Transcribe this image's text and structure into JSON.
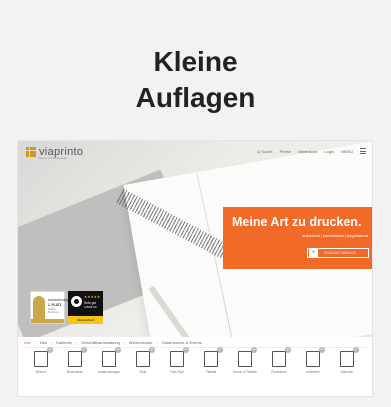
{
  "heading": {
    "line1": "Kleine",
    "line2": "Auflagen"
  },
  "site": {
    "logo_text": "viaprinto",
    "logo_sub": "Meine Art zu drucken",
    "nav": [
      "Q Suche",
      "Preise",
      "Warenkorb",
      "Login",
      "MENU"
    ]
  },
  "banner": {
    "title": "Meine Art zu drucken.",
    "subtitle": "individuell | komfortabel | begeisternd",
    "button_icon": "+",
    "button_label": "PRODUKT WÄHLEN"
  },
  "badges": {
    "quality": {
      "l1": "Auszeichnung",
      "l2": "1. PLATZ",
      "l3": "Online-Druckerei"
    },
    "trusted": {
      "stars": "★★★★★",
      "l1": "Sehr gut",
      "l2": "4.89/5.00",
      "bottom": "Käuferschutz"
    }
  },
  "category_tabs": [
    "Alle",
    "Neu",
    "Kalender",
    "Geschäftsausstattung",
    "Werbedrucke",
    "Gastronomie & Events"
  ],
  "categories": [
    {
      "label": "Bücher"
    },
    {
      "label": "Broschüren"
    },
    {
      "label": "Ausdruckungen"
    },
    {
      "label": "Flyer"
    },
    {
      "label": "Falz-Flyer"
    },
    {
      "label": "Plakate"
    },
    {
      "label": "Druck- & Plakate"
    },
    {
      "label": "Postkarten"
    },
    {
      "label": "Aufkleber"
    },
    {
      "label": "Kalender"
    }
  ],
  "colors": {
    "accent": "#f26a27",
    "gold": "#c89a1e"
  }
}
